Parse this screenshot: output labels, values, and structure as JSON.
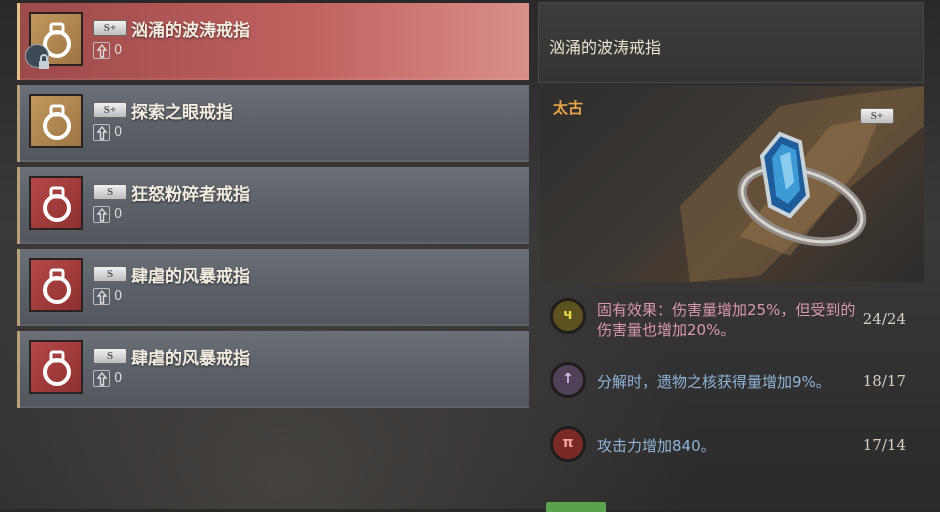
{
  "items": [
    {
      "grade": "S+",
      "name": "汹涌的波涛戒指",
      "count": "0",
      "icon": "ring-gold-icon",
      "locked": true,
      "selected": true
    },
    {
      "grade": "S+",
      "name": "探索之眼戒指",
      "count": "0",
      "icon": "ring-gold-icon",
      "locked": false,
      "selected": false
    },
    {
      "grade": "S",
      "name": "狂怒粉碎者戒指",
      "count": "0",
      "icon": "ring-red-icon",
      "locked": false,
      "selected": false
    },
    {
      "grade": "S",
      "name": "肆虐的风暴戒指",
      "count": "0",
      "icon": "ring-red-icon",
      "locked": false,
      "selected": false
    },
    {
      "grade": "S",
      "name": "肆虐的风暴戒指",
      "count": "0",
      "icon": "ring-red-icon",
      "locked": false,
      "selected": false
    }
  ],
  "detail": {
    "title": "汹涌的波涛戒指",
    "rarity": "太古",
    "grade": "S+",
    "stats": [
      {
        "text": "固有效果：伤害量增加25%，但受到的伤害量也增加20%。",
        "value": "24/24",
        "color": "#d998b0",
        "icon": "glyph-yellow-icon",
        "icon_color": "#d8c53a",
        "icon_char": "ч"
      },
      {
        "text": "分解时，遗物之核获得量增加9%。",
        "value": "18/17",
        "color": "#8fb4d8",
        "icon": "glyph-purple-icon",
        "icon_color": "#b49bc9",
        "icon_char": "↑"
      },
      {
        "text": "攻击力增加840。",
        "value": "17/14",
        "color": "#8fb4d8",
        "icon": "glyph-red-icon",
        "icon_color": "#d0453e",
        "icon_char": "π"
      }
    ]
  },
  "colors": {
    "accent_gold": "#e7a54a",
    "selected_row": "#c0605f"
  }
}
